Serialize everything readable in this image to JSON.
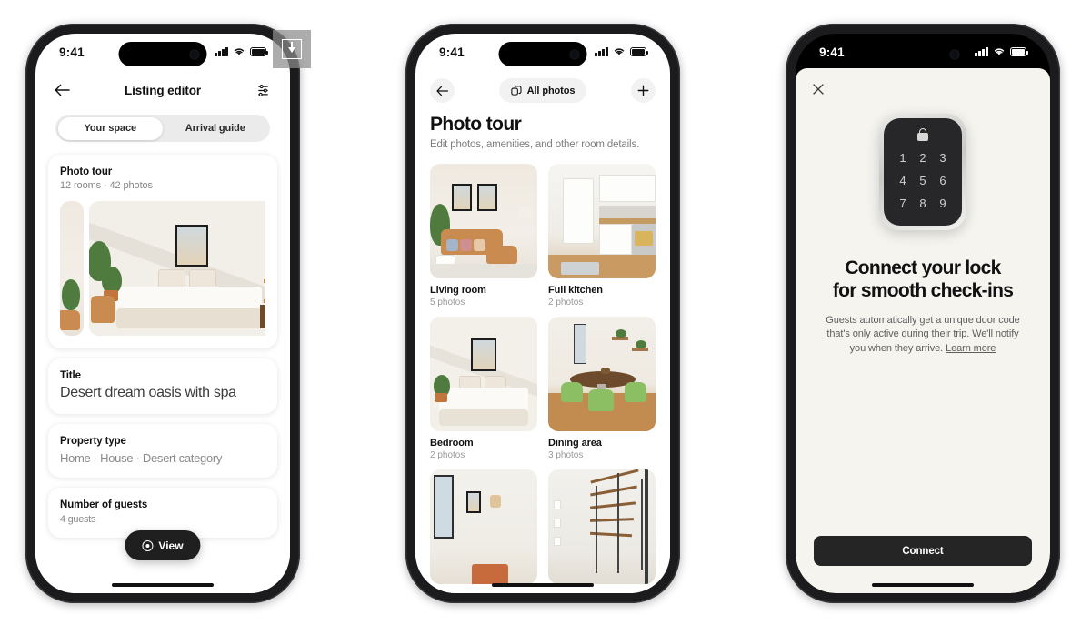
{
  "overlay": {
    "icon": "download-icon"
  },
  "phone1": {
    "status": {
      "time": "9:41",
      "signal": "cellular-signal-icon",
      "wifi": "wifi-icon",
      "battery": "battery-icon"
    },
    "nav": {
      "back": "back-arrow-icon",
      "title": "Listing editor",
      "settings": "sliders-icon"
    },
    "segmented": {
      "options": [
        "Your space",
        "Arrival guide"
      ],
      "selected": "Your space"
    },
    "cards": [
      {
        "title": "Photo tour",
        "subtitle": "12 rooms · 42 photos",
        "media": "bedroom-carousel"
      },
      {
        "title": "Title",
        "value": "Desert dream oasis with spa"
      },
      {
        "title": "Property type",
        "value": "Home · House · Desert category"
      },
      {
        "title": "Number of guests",
        "value": "4 guests"
      }
    ],
    "view_button": {
      "label": "View",
      "icon": "eye-icon"
    }
  },
  "phone2": {
    "status": {
      "time": "9:41"
    },
    "nav": {
      "back": "back-arrow-icon",
      "all_photos": "All photos",
      "all_photos_icon": "photos-stack-icon",
      "add": "plus-icon"
    },
    "heading": "Photo tour",
    "subheading": "Edit photos, amenities, and other room details.",
    "rooms": [
      {
        "name": "Living room",
        "count": "5 photos",
        "image": "living-room-photo"
      },
      {
        "name": "Full kitchen",
        "count": "2 photos",
        "image": "kitchen-photo"
      },
      {
        "name": "Bedroom",
        "count": "2 photos",
        "image": "bedroom-photo"
      },
      {
        "name": "Dining area",
        "count": "3 photos",
        "image": "dining-area-photo"
      },
      {
        "name": "",
        "count": "",
        "image": "hallway-photo"
      },
      {
        "name": "",
        "count": "",
        "image": "staircase-photo"
      }
    ]
  },
  "phone3": {
    "status": {
      "time": "9:41"
    },
    "close": "close-icon",
    "device": {
      "name": "smart-lock-keypad",
      "lock_icon": "lock-icon",
      "keys": [
        "1",
        "2",
        "3",
        "4",
        "5",
        "6",
        "7",
        "8",
        "9"
      ]
    },
    "title_line1": "Connect your lock",
    "title_line2": "for smooth check-ins",
    "description": "Guests automatically get a unique door code that's only active during their trip. We'll notify you when they arrive. ",
    "learn_more": "Learn more",
    "connect_button": "Connect"
  }
}
